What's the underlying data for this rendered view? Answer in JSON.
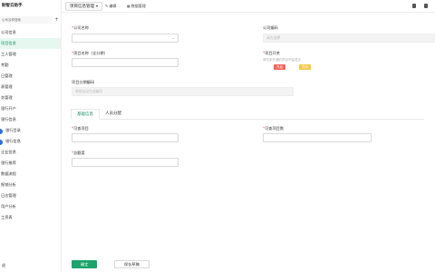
{
  "sidebar": {
    "brand": "财智云助手",
    "search_placeholder": "公司名称搜索",
    "add_label": "+",
    "items": [
      {
        "label": "公司信息"
      },
      {
        "label": "项目信息"
      },
      {
        "label": "工人管理"
      },
      {
        "label": "考勤"
      },
      {
        "label": "日管理"
      },
      {
        "label": "表管理"
      },
      {
        "label": "务管理"
      },
      {
        "label": "银行开户"
      },
      {
        "label": "银行信息"
      },
      {
        "label": "银行目录"
      },
      {
        "label": "银行信息"
      },
      {
        "label": "企业信息"
      },
      {
        "label": "银行推荐"
      },
      {
        "label": "数据流程"
      },
      {
        "label": "报销分析"
      },
      {
        "label": "日志管理"
      },
      {
        "label": "用户分析"
      },
      {
        "label": "工资表"
      }
    ],
    "last": "退"
  },
  "topbar": {
    "tab_label": "项目信息管理",
    "edit_label": "编辑",
    "data_label": "数据管理"
  },
  "form": {
    "company_name_label": "公司名称",
    "company_code_label": "公司编码",
    "company_code_placeholder": "请先选择",
    "project_name_label": "项目名称（全分期）",
    "project_switch_label": "项目开关",
    "project_switch_hint": "请勿未开通的项目不会显示",
    "tag_off": "开启",
    "tag_on": "关闭",
    "project_code_label": "项目分期编码",
    "project_code_placeholder": "系统自动生成编号"
  },
  "tabs": {
    "basic": "基础信息",
    "personnel": "人员分配"
  },
  "sub_form": {
    "field1_label": "可查项目",
    "field2_label": "可查项目数",
    "field3_label": "总额度"
  },
  "actions": {
    "confirm": "确定",
    "save_draft": "保存草稿"
  },
  "colors": {
    "primary": "#1aa36b",
    "active_tab": "#1a8f62",
    "tag_red": "#f2645a",
    "tag_yellow": "#f7c948"
  }
}
